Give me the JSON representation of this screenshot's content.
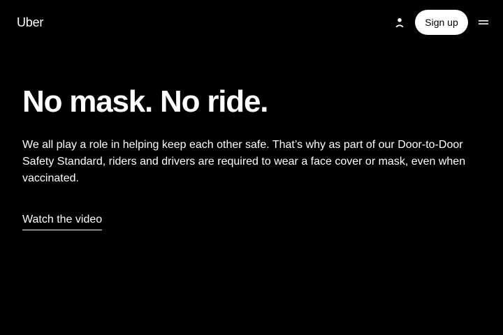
{
  "header": {
    "logo_text": "Uber",
    "user_icon": "person-icon",
    "signup_label": "Sign up",
    "menu_icon": "hamburger-menu-icon"
  },
  "hero": {
    "headline": "No mask. No ride.",
    "body": "We all play a role in helping keep each other safe. That’s why as part of our Door-to-Door Safety Standard, riders and drivers are required to wear a face cover or mask, even when vaccinated.",
    "video_link_label": "Watch the video"
  },
  "colors": {
    "background": "#000000",
    "text": "#ffffff",
    "button_bg": "#ffffff",
    "button_text": "#000000"
  }
}
